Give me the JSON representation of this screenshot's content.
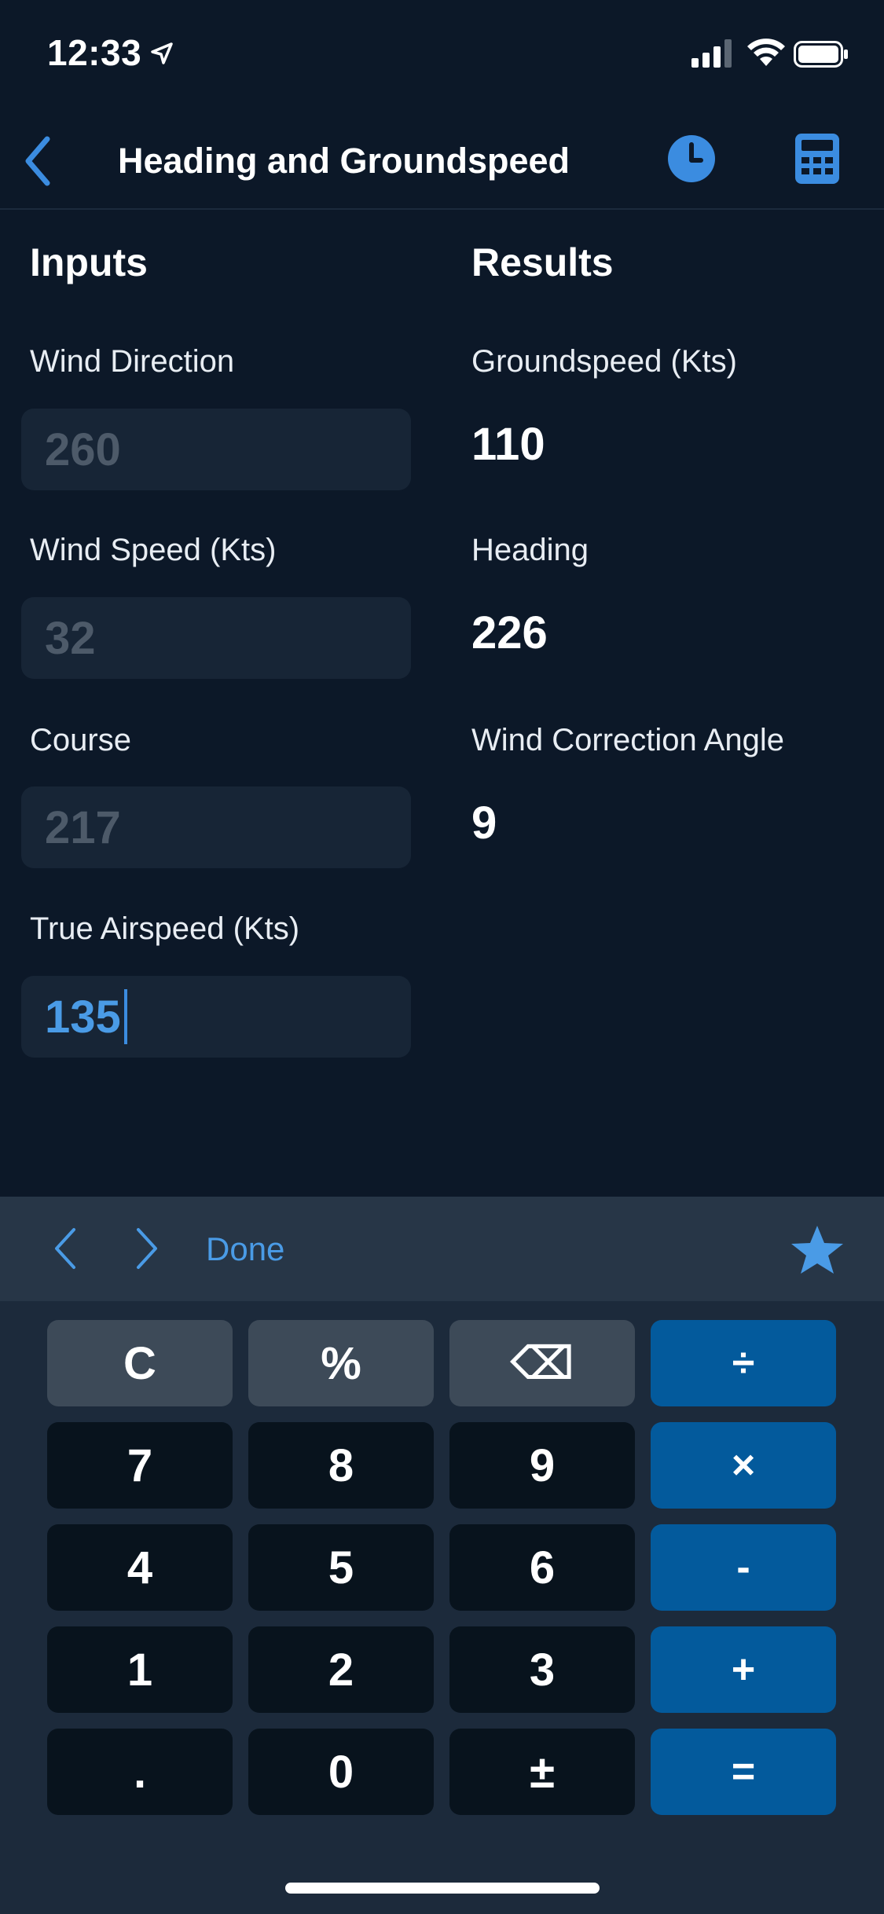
{
  "status_bar": {
    "time": "12:33"
  },
  "nav": {
    "title": "Heading and Groundspeed"
  },
  "inputs": {
    "heading": "Inputs",
    "fields": [
      {
        "label": "Wind Direction",
        "value": "260"
      },
      {
        "label": "Wind Speed (Kts)",
        "value": "32"
      },
      {
        "label": "Course",
        "value": "217"
      },
      {
        "label": "True Airspeed (Kts)",
        "value": "135"
      }
    ]
  },
  "results": {
    "heading": "Results",
    "items": [
      {
        "label": "Groundspeed (Kts)",
        "value": "110"
      },
      {
        "label": "Heading",
        "value": "226"
      },
      {
        "label": "Wind Correction Angle",
        "value": "9"
      }
    ]
  },
  "accessory": {
    "done_label": "Done"
  },
  "keypad": {
    "rows": [
      [
        "C",
        "%",
        "⌫",
        "÷"
      ],
      [
        "7",
        "8",
        "9",
        "×"
      ],
      [
        "4",
        "5",
        "6",
        "-"
      ],
      [
        "1",
        "2",
        "3",
        "+"
      ],
      [
        ".",
        "0",
        "±",
        "="
      ]
    ]
  },
  "colors": {
    "background": "#0c1828",
    "accent": "#4a9be6",
    "operator_key": "#035a9c",
    "function_key": "#3d4a58",
    "digit_key": "#08131d"
  }
}
